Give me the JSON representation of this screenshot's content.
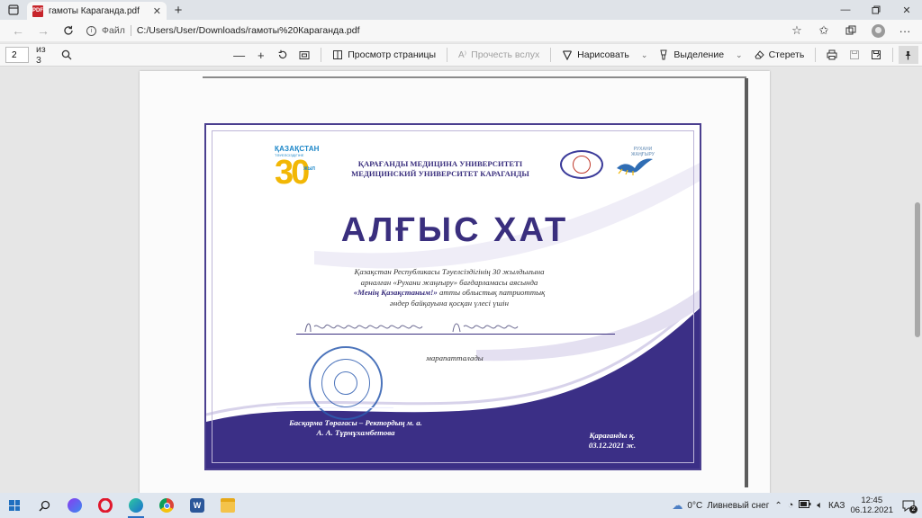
{
  "browser": {
    "tab_title": "гамоты Караганда.pdf",
    "pdf_favicon": "PDF",
    "new_tab": "+",
    "address_label": "Файл",
    "url": "C:/Users/User/Downloads/гамоты%20Караганда.pdf"
  },
  "pdf_toolbar": {
    "page_current": "2",
    "page_of": "из 3",
    "page_view_label": "Просмотр страницы",
    "read_aloud_label": "Прочесть вслух",
    "draw_label": "Нарисовать",
    "highlight_label": "Выделение",
    "erase_label": "Стереть"
  },
  "certificate": {
    "logo_kz": "ҚАЗАҚСТАН",
    "logo_sub": "ТӘУЕЛСІЗДІГІНЕ",
    "logo_num": "30",
    "logo_jyl": "ЖЫЛ",
    "univ_line1": "ҚАРАҒАНДЫ МЕДИЦИНА УНИВЕРСИТЕТІ",
    "univ_line2": "МЕДИЦИНСКИЙ УНИВЕРСИТЕТ КАРАГАНДЫ",
    "rukhani_line1": "РУХАНИ",
    "rukhani_line2": "ЖАҢҒЫРУ",
    "title": "АЛҒЫС ХАТ",
    "body_line1": "Қазақстан Республикасы Тәуелсіздігінің 30 жылдығына",
    "body_line2": "арналған «Рухани жаңғыру» бағдарламасы аясында",
    "body_line3_bold": "«Менің Қазақстаным!»",
    "body_line3_rest": " атты облыстық патриоттық",
    "body_line4": "әндер байқауына қосқан үлесі үшін",
    "awarded": "марапатталады",
    "signer_line1": "Басқарма Төрағасы – Ректордың м. а.",
    "signer_line2": "А. А. Тұрмұхамбетова",
    "place_line1": "Қарағанды қ.",
    "place_line2": "03.12.2021 ж."
  },
  "taskbar": {
    "word_label": "W",
    "temperature": "0°C",
    "weather_desc": "Ливневый снег",
    "language": "КАЗ",
    "time": "12:45",
    "date": "06.12.2021",
    "notifications_count": "2"
  },
  "colors": {
    "accent_purple": "#3a2f7e",
    "tab_bar": "#dfe3e8",
    "taskbar": "#dfe6ef"
  }
}
